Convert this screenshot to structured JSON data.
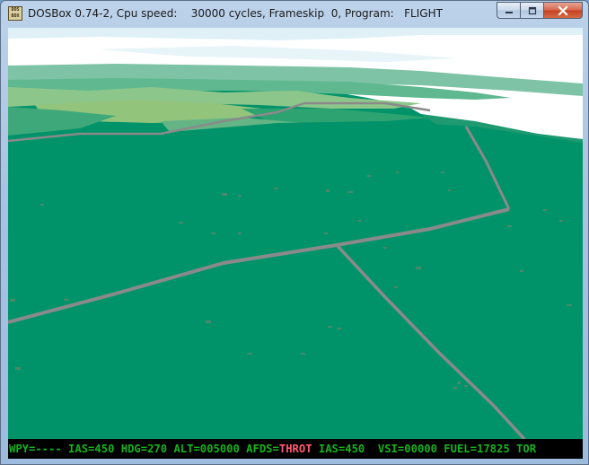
{
  "window": {
    "title": "DOSBox 0.74-2, Cpu speed:    30000 cycles, Frameskip  0, Program:   FLIGHT",
    "icon_name": "dosbox-icon",
    "icon_text": "DOS BOX",
    "buttons": {
      "minimize": "minimize-icon",
      "maximize": "maximize-icon",
      "close": "close-icon"
    }
  },
  "scene": {
    "ground_color": "#00936a",
    "sky_color": "#ffffff",
    "horizon_color": "#3aab68",
    "road_color": "#8a8a8a"
  },
  "hud": {
    "wpy": "WPY=---- ",
    "ias": "IAS=450 ",
    "hdg": "HDG=270 ",
    "alt": "ALT=005000 ",
    "afds_label": "AFDS=",
    "afds_value": "THROT",
    "ias2": " IAS=450  ",
    "vsi": "VSI=00000 ",
    "fuel": "FUEL=17825 ",
    "tor": "TOR",
    "colors": {
      "text": "#15b31c",
      "warning": "#ff5a72",
      "background": "#000000"
    }
  }
}
